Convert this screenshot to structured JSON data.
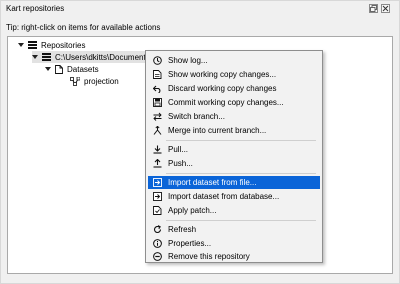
{
  "panel": {
    "title": "Kart repositories",
    "tip": "Tip: right-click on items for available actions"
  },
  "tree": {
    "root_label": "Repositories",
    "repo_label": "C:\\Users\\dkitts\\Documents",
    "datasets_label": "Datasets",
    "dataset_label": "projection"
  },
  "menu": {
    "items": [
      {
        "label": "Show log...",
        "icon": "log-icon"
      },
      {
        "label": "Show working copy changes...",
        "icon": "changes-icon"
      },
      {
        "label": "Discard working copy changes",
        "icon": "undo-icon"
      },
      {
        "label": "Commit working copy changes...",
        "icon": "commit-icon"
      },
      {
        "label": "Switch branch...",
        "icon": "switch-icon"
      },
      {
        "label": "Merge into current branch...",
        "icon": "merge-icon"
      },
      {
        "label": "Pull...",
        "icon": "download-icon"
      },
      {
        "label": "Push...",
        "icon": "upload-icon"
      },
      {
        "label": "Import dataset from file...",
        "icon": "import-file-icon"
      },
      {
        "label": "Import dataset from database...",
        "icon": "import-db-icon"
      },
      {
        "label": "Apply patch...",
        "icon": "patch-icon"
      },
      {
        "label": "Refresh",
        "icon": "refresh-icon"
      },
      {
        "label": "Properties...",
        "icon": "info-icon"
      },
      {
        "label": "Remove this repository",
        "icon": "remove-icon"
      }
    ],
    "highlighted_index": 8
  }
}
